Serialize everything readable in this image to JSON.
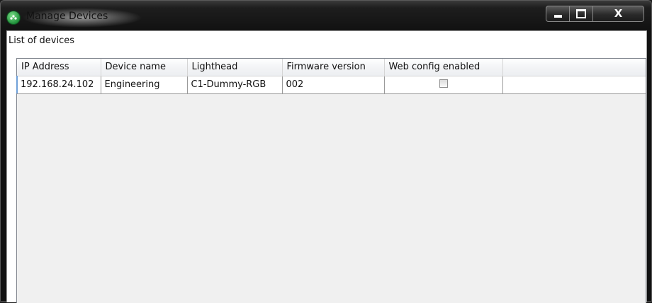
{
  "window": {
    "title": "Manage Devices",
    "app_icon": "app-logo-icon",
    "controls": {
      "minimize_icon": "minimize-icon",
      "maximize_icon": "maximize-icon",
      "close_label": "X"
    }
  },
  "main": {
    "section_label": "List of devices",
    "columns": [
      "IP Address",
      "Device name",
      "Lighthead",
      "Firmware version",
      "Web config enabled"
    ],
    "rows": [
      {
        "ip": "192.168.24.102",
        "device_name": "Engineering",
        "lighthead": "C1-Dummy-RGB",
        "firmware": "002",
        "web_config_enabled": false
      }
    ]
  },
  "colors": {
    "title_bar": "#1e1e1e",
    "app_icon_green": "#2ea84a",
    "grid_empty": "#f0f0f0",
    "row_marker": "#6fa0d8"
  }
}
